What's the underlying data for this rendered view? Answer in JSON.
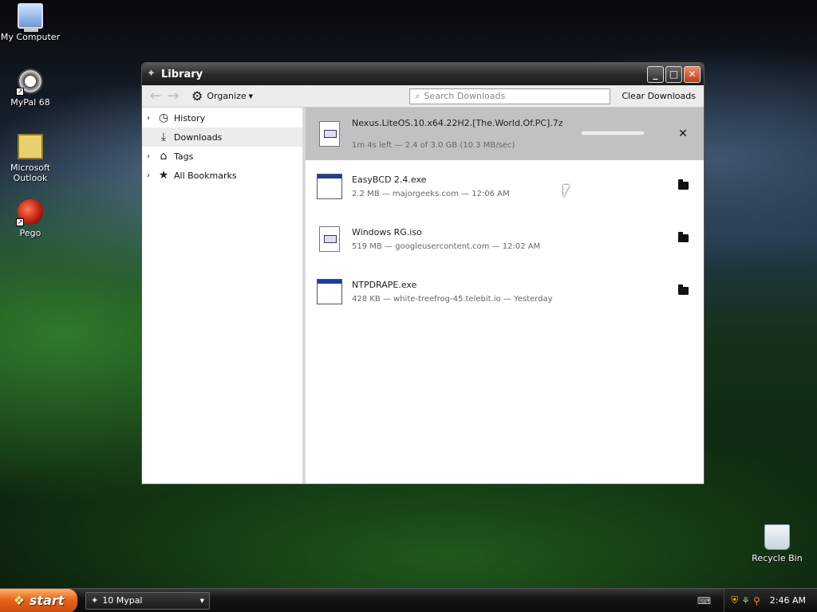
{
  "desktop": {
    "icons": [
      {
        "label": "My Computer",
        "icon": "computer-icon"
      },
      {
        "label": "MyPal 68",
        "icon": "mypal-icon"
      },
      {
        "label": "Microsoft Outlook",
        "icon": "outlook-icon"
      },
      {
        "label": "Pego",
        "icon": "pego-icon"
      },
      {
        "label": "Recycle Bin",
        "icon": "recycle-bin-icon"
      }
    ]
  },
  "window": {
    "title": "Library",
    "controls": {
      "minimize": "_",
      "maximize": "□",
      "close": "✕"
    }
  },
  "toolbar": {
    "organize_label": "Organize",
    "search_placeholder": "Search Downloads",
    "clear_label": "Clear Downloads"
  },
  "sidebar": {
    "items": [
      {
        "label": "History",
        "icon": "clock-icon",
        "expandable": true
      },
      {
        "label": "Downloads",
        "icon": "download-icon",
        "expandable": false,
        "selected": true
      },
      {
        "label": "Tags",
        "icon": "tag-icon",
        "expandable": true
      },
      {
        "label": "All Bookmarks",
        "icon": "star-icon",
        "expandable": true
      }
    ]
  },
  "downloads": [
    {
      "name": "Nexus.LiteOS.10.x64.22H2.[The.World.Of.PC].7z",
      "meta": "1m 4s left — 2.4 of 3.0 GB (10.3 MB/sec)",
      "active": true,
      "progress": 0.0,
      "action": "cancel"
    },
    {
      "name": "EasyBCD 2.4.exe",
      "meta": "2.2 MB — majorgeeks.com — 12:06 AM",
      "active": false,
      "action": "open-folder"
    },
    {
      "name": "Windows RG.iso",
      "meta": "519 MB — googleusercontent.com — 12:02 AM",
      "active": false,
      "action": "open-folder"
    },
    {
      "name": "NTPDRAPE.exe",
      "meta": "428 KB — white-treefrog-45.telebit.io — Yesterday",
      "active": false,
      "action": "open-folder"
    }
  ],
  "taskbar": {
    "start_label": "start",
    "task_label": "10 Mypal",
    "clock": "2:46 AM"
  }
}
